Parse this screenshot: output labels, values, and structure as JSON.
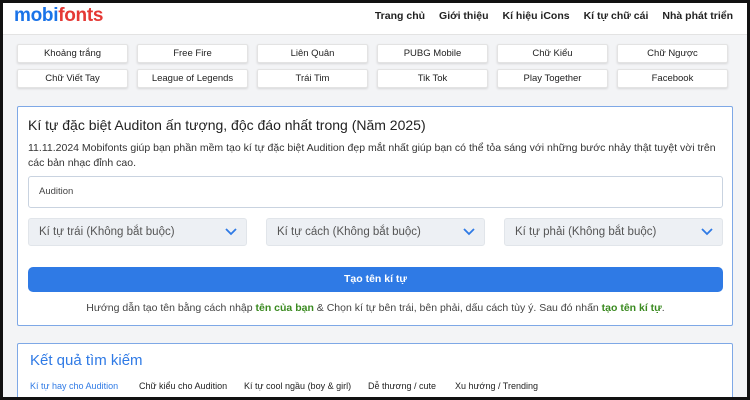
{
  "header": {
    "logo_part1": "mobi",
    "logo_part2": "fonts",
    "nav": [
      "Trang chủ",
      "Giới thiệu",
      "Kí hiệu iCons",
      "Kí tự chữ cái",
      "Nhà phát triển"
    ]
  },
  "categories": [
    "Khoảng trắng",
    "Free Fire",
    "Liên Quân",
    "PUBG Mobile",
    "Chữ Kiểu",
    "Chữ Ngược",
    "Chữ Viết Tay",
    "League of Legends",
    "Trái Tim",
    "Tik Tok",
    "Play Together",
    "Facebook"
  ],
  "generator": {
    "title": "Kí tự đặc biệt Auditon ấn tượng, độc đáo nhất trong (Năm 2025)",
    "description": "11.11.2024 Mobifonts giúp bạn phần mềm tạo kí tự đặc biệt Audition đẹp mắt nhất giúp bạn có thể tỏa sáng với những bước nhảy thật tuyệt vời trên các bản nhạc đỉnh cao.",
    "input_value": "Audition",
    "select_left": "Kí tự trái (Không bắt buộc)",
    "select_middle": "Kí tự cách (Không bắt buộc)",
    "select_right": "Kí tự phải (Không bắt buộc)",
    "button_label": "Tạo tên kí tự",
    "guide_part1": "Hướng dẫn tạo tên bằng cách nhập ",
    "guide_highlight1": "tên của bạn",
    "guide_part2": " & Chọn kí tự bên trái, bên phải, dấu cách tùy ý. Sau đó nhấn ",
    "guide_highlight2": "tạo tên kí tự",
    "guide_part3": "."
  },
  "results": {
    "title": "Kết quả tìm kiếm",
    "tabs": [
      "Kí tự hay cho Audition",
      "Chữ kiểu cho Audition",
      "Kí tự cool ngầu (boy & girl)",
      "Dễ thương / cute",
      "Xu hướng / Trending"
    ]
  },
  "colors": {
    "accent": "#2f7ae5",
    "logo_blue": "#1a73e8",
    "logo_red": "#e53935",
    "highlight_green": "#3a8a20"
  }
}
